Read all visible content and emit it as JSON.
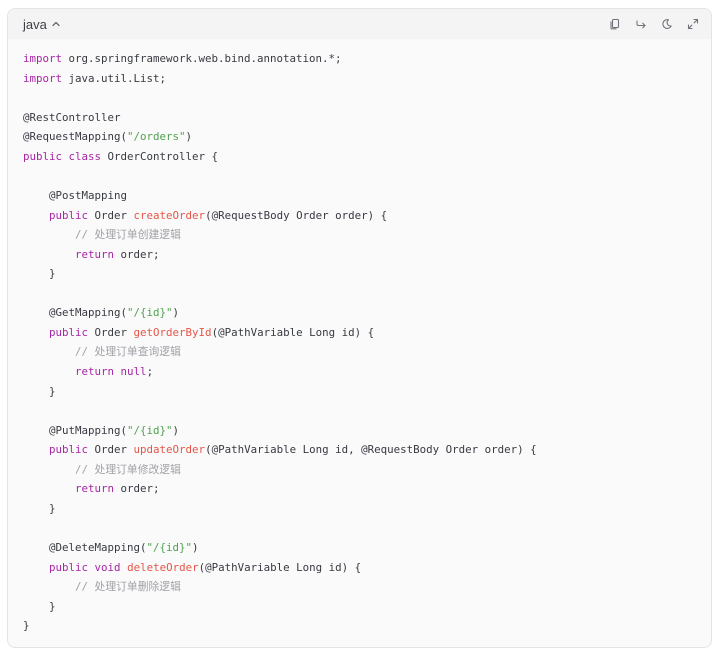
{
  "header": {
    "language_label": "java",
    "copy_icon": "copy-icon",
    "wrap_icon": "wrap-icon",
    "theme_icon": "theme-icon",
    "expand_icon": "expand-icon"
  },
  "colors": {
    "keyword": "#a626a4",
    "function": "#e45649",
    "string": "#50a14f",
    "comment": "#a0a1a7",
    "text": "#383a42"
  },
  "code": {
    "lines": [
      [
        {
          "t": "import",
          "c": "kw"
        },
        {
          "t": " org.springframework.web.bind.annotation.*;"
        }
      ],
      [
        {
          "t": "import",
          "c": "kw"
        },
        {
          "t": " java.util.List;"
        }
      ],
      [],
      [
        {
          "t": "@RestController"
        }
      ],
      [
        {
          "t": "@RequestMapping("
        },
        {
          "t": "\"/orders\"",
          "c": "str"
        },
        {
          "t": ")"
        }
      ],
      [
        {
          "t": "public",
          "c": "kw"
        },
        {
          "t": " "
        },
        {
          "t": "class",
          "c": "kw"
        },
        {
          "t": " OrderController {"
        }
      ],
      [],
      [
        {
          "t": "    @PostMapping"
        }
      ],
      [
        {
          "t": "    "
        },
        {
          "t": "public",
          "c": "kw"
        },
        {
          "t": " Order "
        },
        {
          "t": "createOrder",
          "c": "fn"
        },
        {
          "t": "(@RequestBody Order order) {"
        }
      ],
      [
        {
          "t": "        "
        },
        {
          "t": "// 处理订单创建逻辑",
          "c": "cm"
        }
      ],
      [
        {
          "t": "        "
        },
        {
          "t": "return",
          "c": "kw"
        },
        {
          "t": " order;"
        }
      ],
      [
        {
          "t": "    }"
        }
      ],
      [],
      [
        {
          "t": "    @GetMapping("
        },
        {
          "t": "\"/{id}\"",
          "c": "str"
        },
        {
          "t": ")"
        }
      ],
      [
        {
          "t": "    "
        },
        {
          "t": "public",
          "c": "kw"
        },
        {
          "t": " Order "
        },
        {
          "t": "getOrderById",
          "c": "fn"
        },
        {
          "t": "(@PathVariable Long id) {"
        }
      ],
      [
        {
          "t": "        "
        },
        {
          "t": "// 处理订单查询逻辑",
          "c": "cm"
        }
      ],
      [
        {
          "t": "        "
        },
        {
          "t": "return",
          "c": "kw"
        },
        {
          "t": " "
        },
        {
          "t": "null",
          "c": "kw"
        },
        {
          "t": ";"
        }
      ],
      [
        {
          "t": "    }"
        }
      ],
      [],
      [
        {
          "t": "    @PutMapping("
        },
        {
          "t": "\"/{id}\"",
          "c": "str"
        },
        {
          "t": ")"
        }
      ],
      [
        {
          "t": "    "
        },
        {
          "t": "public",
          "c": "kw"
        },
        {
          "t": " Order "
        },
        {
          "t": "updateOrder",
          "c": "fn"
        },
        {
          "t": "(@PathVariable Long id, @RequestBody Order order) {"
        }
      ],
      [
        {
          "t": "        "
        },
        {
          "t": "// 处理订单修改逻辑",
          "c": "cm"
        }
      ],
      [
        {
          "t": "        "
        },
        {
          "t": "return",
          "c": "kw"
        },
        {
          "t": " order;"
        }
      ],
      [
        {
          "t": "    }"
        }
      ],
      [],
      [
        {
          "t": "    @DeleteMapping("
        },
        {
          "t": "\"/{id}\"",
          "c": "str"
        },
        {
          "t": ")"
        }
      ],
      [
        {
          "t": "    "
        },
        {
          "t": "public",
          "c": "kw"
        },
        {
          "t": " "
        },
        {
          "t": "void",
          "c": "kw"
        },
        {
          "t": " "
        },
        {
          "t": "deleteOrder",
          "c": "fn"
        },
        {
          "t": "(@PathVariable Long id) {"
        }
      ],
      [
        {
          "t": "        "
        },
        {
          "t": "// 处理订单删除逻辑",
          "c": "cm"
        }
      ],
      [
        {
          "t": "    }"
        }
      ],
      [
        {
          "t": "}"
        }
      ]
    ]
  }
}
